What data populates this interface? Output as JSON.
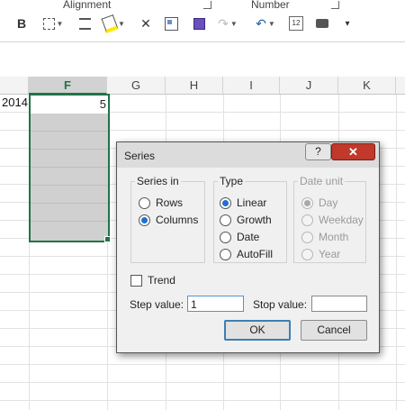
{
  "ribbon": {
    "groups": {
      "alignment": "Alignment",
      "number": "Number"
    },
    "tool_glyphs": {
      "bold": "B",
      "undo": "↶",
      "redo": "↷",
      "delete": "✕",
      "camera": "⌷",
      "more": "▾",
      "calendar_num": "12"
    }
  },
  "sheet": {
    "columns": [
      "F",
      "G",
      "H",
      "I",
      "J",
      "K"
    ],
    "selected_column": "F",
    "row_cell_e": "2014",
    "active_cell_value": "5"
  },
  "dialog": {
    "title": "Series",
    "help": "?",
    "close": "✕",
    "series_in": {
      "legend": "Series in",
      "rows": "Rows",
      "columns": "Columns",
      "selected": "Columns"
    },
    "type": {
      "legend": "Type",
      "linear": "Linear",
      "growth": "Growth",
      "date": "Date",
      "autofill": "AutoFill",
      "selected": "Linear"
    },
    "date_unit": {
      "legend": "Date unit",
      "day": "Day",
      "weekday": "Weekday",
      "month": "Month",
      "year": "Year",
      "selected": "Day",
      "enabled": false
    },
    "trend_label": "Trend",
    "step_label": "Step value:",
    "step_value": "1",
    "stop_label": "Stop value:",
    "stop_value": "",
    "ok": "OK",
    "cancel": "Cancel"
  },
  "colors": {
    "accent_green": "#217346",
    "close_red": "#c0392b"
  }
}
